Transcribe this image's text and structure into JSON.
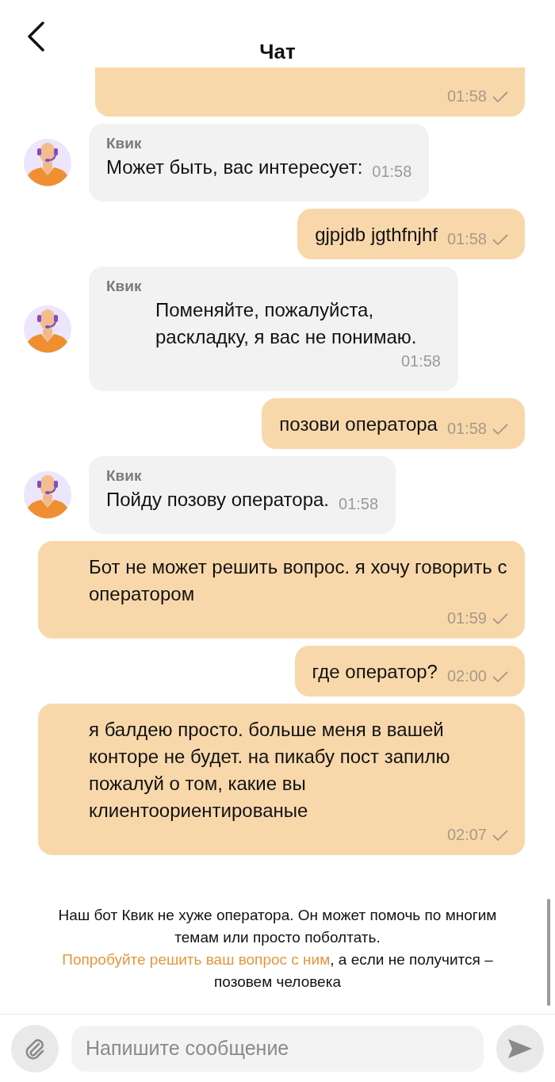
{
  "header": {
    "title": "Чат"
  },
  "messages": [
    {
      "kind": "user",
      "partial": true,
      "time": "01:58",
      "delivered": true
    },
    {
      "kind": "bot",
      "sender": "Квик",
      "text": "Может быть, вас интересует:",
      "time": "01:58"
    },
    {
      "kind": "user",
      "text": "gjpjdb jgthfnjhf",
      "time": "01:58",
      "delivered": true
    },
    {
      "kind": "bot",
      "sender": "Квик",
      "text": "Поменяйте, пожалуйста, раскладку, я вас не понимаю.",
      "time": "01:58"
    },
    {
      "kind": "user",
      "text": "позови оператора",
      "time": "01:58",
      "delivered": true
    },
    {
      "kind": "bot",
      "sender": "Квик",
      "text": "Пойду позову оператора.",
      "time": "01:58"
    },
    {
      "kind": "user",
      "text": "Бот не может решить вопрос. я хочу говорить с оператором",
      "time": "01:59",
      "delivered": true
    },
    {
      "kind": "user",
      "text": "где оператор?",
      "time": "02:00",
      "delivered": true
    },
    {
      "kind": "user",
      "text": "я балдею просто. больше меня в вашей конторе не будет. на пикабу пост запилю пожалуй о том, какие вы клиентоориентированые",
      "time": "02:07",
      "delivered": true
    }
  ],
  "notice": {
    "before": "Наш бот Квик не хуже оператора. Он может помочь по многим темам или просто поболтать.",
    "link": "Попробуйте решить ваш вопрос с ним",
    "after": ", а если не получится – позовем человека"
  },
  "composer": {
    "placeholder": "Напишите сообщение"
  }
}
